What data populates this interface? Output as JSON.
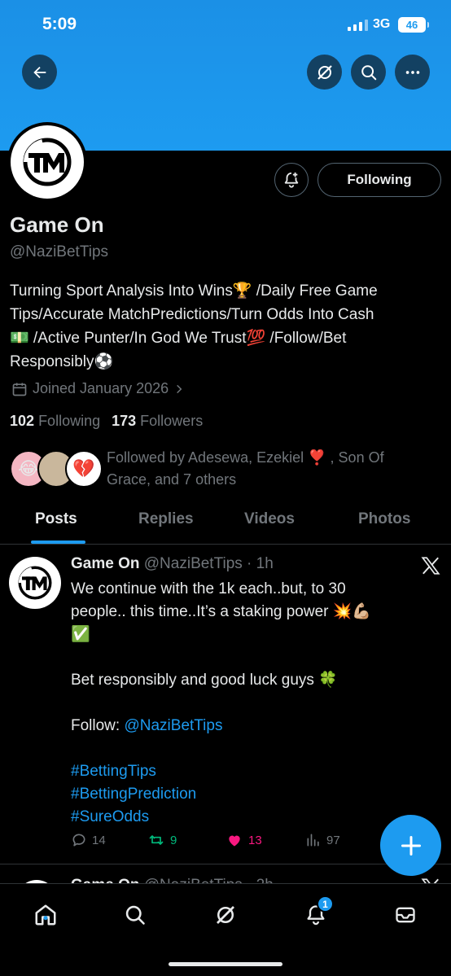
{
  "status_bar": {
    "time": "5:09",
    "network": "3G",
    "battery": "46"
  },
  "profile": {
    "display_name": "Game On",
    "handle": "@NaziBetTips",
    "bio_line1": "Turning Sport Analysis Into Wins🏆 /Daily Free Game",
    "bio_line2": "Tips/Accurate MatchPredictions/Turn Odds Into Cash",
    "bio_line3": "💵 /Active Punter/In God We Trust💯 /Follow/Bet",
    "bio_line4": "Responsibly⚽",
    "joined": "Joined January 2026",
    "following_count": "102",
    "following_label": "Following",
    "followers_count": "173",
    "followers_label": "Followers",
    "followed_by": "Followed by Adesewa, Ezekiel ❣️ , Son Of Grace, and 7 others",
    "follow_button": "Following"
  },
  "tabs": [
    {
      "label": "Posts",
      "active": true
    },
    {
      "label": "Replies",
      "active": false
    },
    {
      "label": "Videos",
      "active": false
    },
    {
      "label": "Photos",
      "active": false
    }
  ],
  "post": {
    "name": "Game On",
    "handle": "@NaziBetTips",
    "time": "1h",
    "line1": "We continue with the 1k each..but, to 30",
    "line2": "people.. this time..It’s a staking power 💥💪🏼",
    "line3": "✅",
    "line4": "Bet responsibly and good luck guys 🍀",
    "follow_prefix": "Follow: ",
    "follow_link": "@NaziBetTips",
    "hashtag1": "#BettingTips",
    "hashtag2": "#BettingPrediction",
    "hashtag3": "#SureOdds",
    "replies": "14",
    "reposts": "9",
    "likes": "13",
    "views": "97"
  },
  "next_post": {
    "name": "Game On",
    "meta": "@NaziBetTips · 2h"
  },
  "nav": {
    "notification_badge": "1"
  },
  "colors": {
    "accent": "#1d9bf0",
    "background": "#000000",
    "repost": "#00ba7c",
    "like": "#f91880",
    "muted": "#71767b"
  },
  "icons": [
    "back-arrow-icon",
    "grok-icon",
    "search-icon",
    "more-icon",
    "bell-add-icon",
    "calendar-icon",
    "chevron-right-icon",
    "reply-icon",
    "repost-icon",
    "heart-icon",
    "views-icon",
    "plus-icon",
    "home-icon",
    "notifications-icon",
    "messages-icon",
    "x-logo-icon"
  ]
}
